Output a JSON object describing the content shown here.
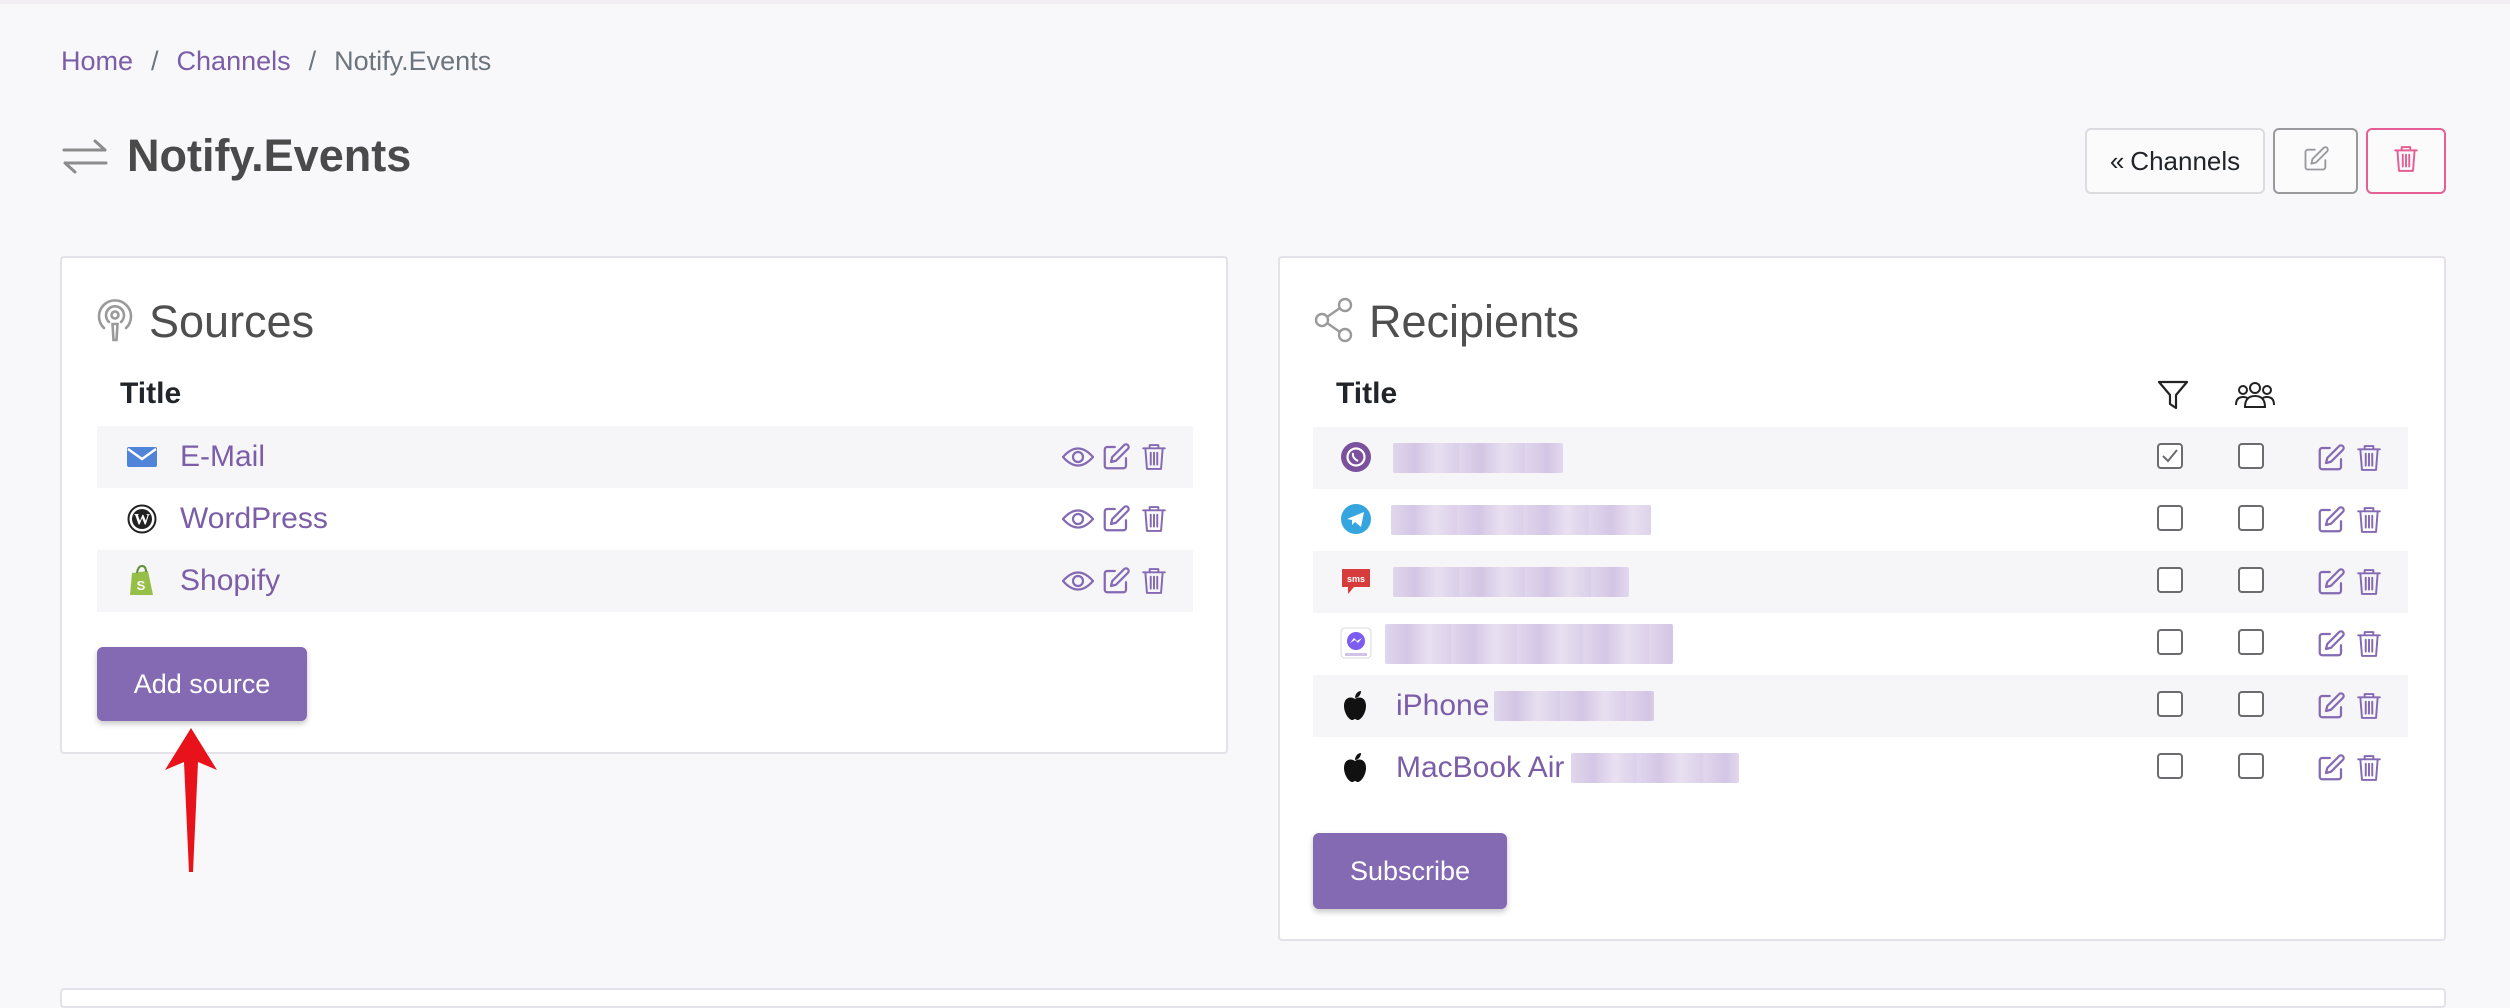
{
  "breadcrumb": {
    "home": "Home",
    "separator": "/",
    "channels": "Channels",
    "current": "Notify.Events"
  },
  "page": {
    "title": "Notify.Events",
    "title_icon": "arrows-exchange-icon"
  },
  "top_actions": {
    "channels_label": "Channels",
    "channels_icon": "double-chevron-left-icon",
    "edit_icon": "pencil-square-icon",
    "delete_icon": "trash-icon"
  },
  "sources": {
    "title": "Sources",
    "icon": "podcast-icon",
    "column_title": "Title",
    "items": [
      {
        "name": "E-Mail",
        "icon": "email-icon"
      },
      {
        "name": "WordPress",
        "icon": "wordpress-icon"
      },
      {
        "name": "Shopify",
        "icon": "shopify-icon"
      }
    ],
    "add_button": "Add source"
  },
  "recipients": {
    "title": "Recipients",
    "icon": "share-icon",
    "column_title": "Title",
    "filter_icon": "filter-icon",
    "group_icon": "users-icon",
    "items": [
      {
        "name": "",
        "icon": "viber-icon",
        "filter_checked": true,
        "group_checked": false
      },
      {
        "name": "",
        "icon": "telegram-icon",
        "filter_checked": false,
        "group_checked": false
      },
      {
        "name": "",
        "icon": "sms-icon",
        "filter_checked": false,
        "group_checked": false
      },
      {
        "name": "",
        "icon": "messenger-icon",
        "filter_checked": false,
        "group_checked": false
      },
      {
        "name": "iPhone",
        "icon": "apple-icon",
        "filter_checked": false,
        "group_checked": false
      },
      {
        "name": "MacBook Air",
        "icon": "apple-icon",
        "filter_checked": false,
        "group_checked": false
      }
    ],
    "subscribe_button": "Subscribe"
  },
  "colors": {
    "accent": "#8469b3",
    "link": "#7b5ea7",
    "danger": "#e55f95",
    "annotation_arrow": "#e8121a"
  }
}
